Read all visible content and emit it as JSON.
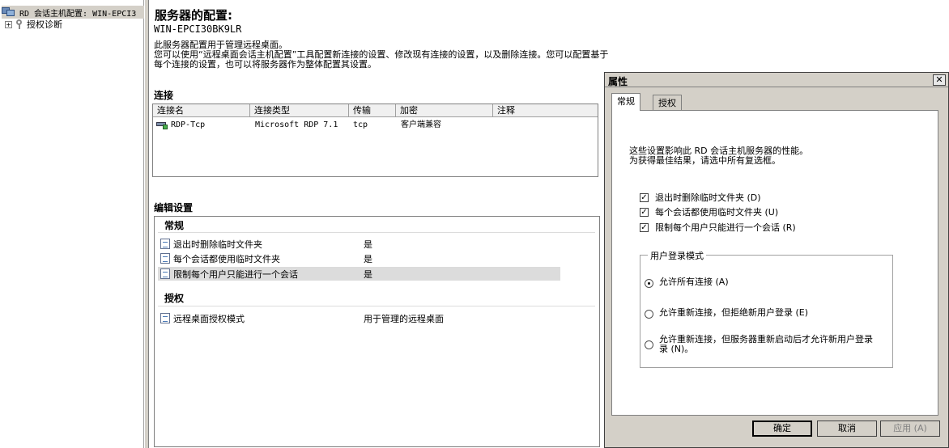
{
  "tree": {
    "root_label": "RD 会话主机配置: WIN-EPCI3",
    "root_expander": "",
    "child_expander": "+",
    "child_label": "授权诊断"
  },
  "main": {
    "title": "服务器的配置:",
    "server_name": "WIN-EPCI30BK9LR",
    "description": [
      "此服务器配置用于管理远程桌面。",
      "您可以使用“远程桌面会话主机配置”工具配置新连接的设置、修改现有连接的设置，以及删除连接。您可以配置基于",
      "每个连接的设置，也可以将服务器作为整体配置其设置。"
    ],
    "connections_heading": "连接",
    "connections_table": {
      "columns": [
        "连接名",
        "连接类型",
        "传输",
        "加密",
        "注释"
      ],
      "rows": [
        {
          "name": "RDP-Tcp",
          "type": "Microsoft RDP 7.1",
          "transport": "tcp",
          "encryption": "客户端兼容",
          "comment": ""
        }
      ]
    },
    "edit_heading": "编辑设置",
    "groups": [
      {
        "title": "常规",
        "items": [
          {
            "name": "退出时删除临时文件夹",
            "value": "是"
          },
          {
            "name": "每个会话都使用临时文件夹",
            "value": "是"
          },
          {
            "name": "限制每个用户只能进行一个会话",
            "value": "是"
          }
        ]
      },
      {
        "title": "授权",
        "items": [
          {
            "name": "远程桌面授权模式",
            "value": "用于管理的远程桌面"
          }
        ]
      }
    ]
  },
  "dialog": {
    "title": "属性",
    "close_glyph": "✕",
    "tabs": [
      "常规",
      "授权"
    ],
    "intro": [
      "这些设置影响此 RD 会话主机服务器的性能。",
      "为获得最佳结果，请选中所有复选框。"
    ],
    "checkboxes": [
      {
        "label": "退出时删除临时文件夹 (D)",
        "checked": true
      },
      {
        "label": "每个会话都使用临时文件夹 (U)",
        "checked": true
      },
      {
        "label": "限制每个用户只能进行一个会话 (R)",
        "checked": true
      }
    ],
    "login_mode_label": "用户登录模式",
    "radios": [
      {
        "label": "允许所有连接 (A)",
        "selected": true
      },
      {
        "label": "允许重新连接，但拒绝新用户登录 (E)",
        "selected": false
      },
      {
        "label": "允许重新连接，但服务器重新启动后才允许新用户登录",
        "label2": "录 (N)。",
        "selected": false
      }
    ],
    "buttons": {
      "ok": "确定",
      "cancel": "取消",
      "apply": "应用 (A)"
    }
  }
}
